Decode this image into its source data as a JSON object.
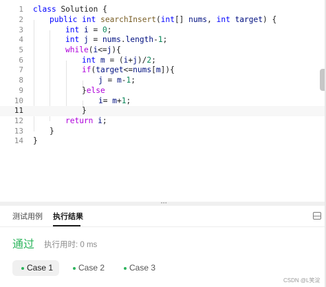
{
  "editor": {
    "line_numbers": [
      "1",
      "2",
      "3",
      "4",
      "5",
      "6",
      "7",
      "8",
      "9",
      "10",
      "11",
      "12",
      "13",
      "14"
    ],
    "current_line": "11",
    "code": {
      "l1": [
        "class",
        " ",
        "Solution",
        " {"
      ],
      "l2": [
        "public",
        " ",
        "int",
        " ",
        "searchInsert",
        "(",
        "int",
        "[] ",
        "nums",
        ", ",
        "int",
        " ",
        "target",
        ") {"
      ],
      "l3": [
        "int",
        " ",
        "i",
        " = ",
        "0",
        ";"
      ],
      "l4": [
        "int",
        " ",
        "j",
        " = ",
        "nums",
        ".",
        "length",
        "-",
        "1",
        ";"
      ],
      "l5": [
        "while",
        "(",
        "i",
        "<=",
        "j",
        "){"
      ],
      "l6": [
        "int",
        " ",
        "m",
        " = (",
        "i",
        "+",
        "j",
        ")/",
        "2",
        ";"
      ],
      "l7": [
        "if",
        "(",
        "target",
        "<=",
        "nums",
        "[",
        "m",
        "]){"
      ],
      "l8": [
        "j",
        " = ",
        "m",
        "-",
        "1",
        ";"
      ],
      "l9": [
        "}",
        "else"
      ],
      "l10": [
        "i",
        "= ",
        "m",
        "+",
        "1",
        ";"
      ],
      "l11": [
        "}"
      ],
      "l12": [
        "return",
        " ",
        "i",
        ";"
      ],
      "l13": [
        "}"
      ],
      "l14": [
        "}"
      ]
    }
  },
  "panel": {
    "tabs": [
      "测试用例",
      "执行结果"
    ],
    "active_tab": "执行结果",
    "status": "通过",
    "runtime": "执行用时: 0 ms",
    "cases": [
      "Case 1",
      "Case 2",
      "Case 3"
    ],
    "active_case": "Case 1"
  },
  "watermark": "CSDN @L笑淀",
  "colors": {
    "success": "#2db55d",
    "keyword": "#0000ff",
    "control": "#af00db",
    "number": "#098658"
  },
  "icons": {
    "panel_toggle": "layout-panel-icon",
    "splitter": "drag-handle-icon"
  }
}
